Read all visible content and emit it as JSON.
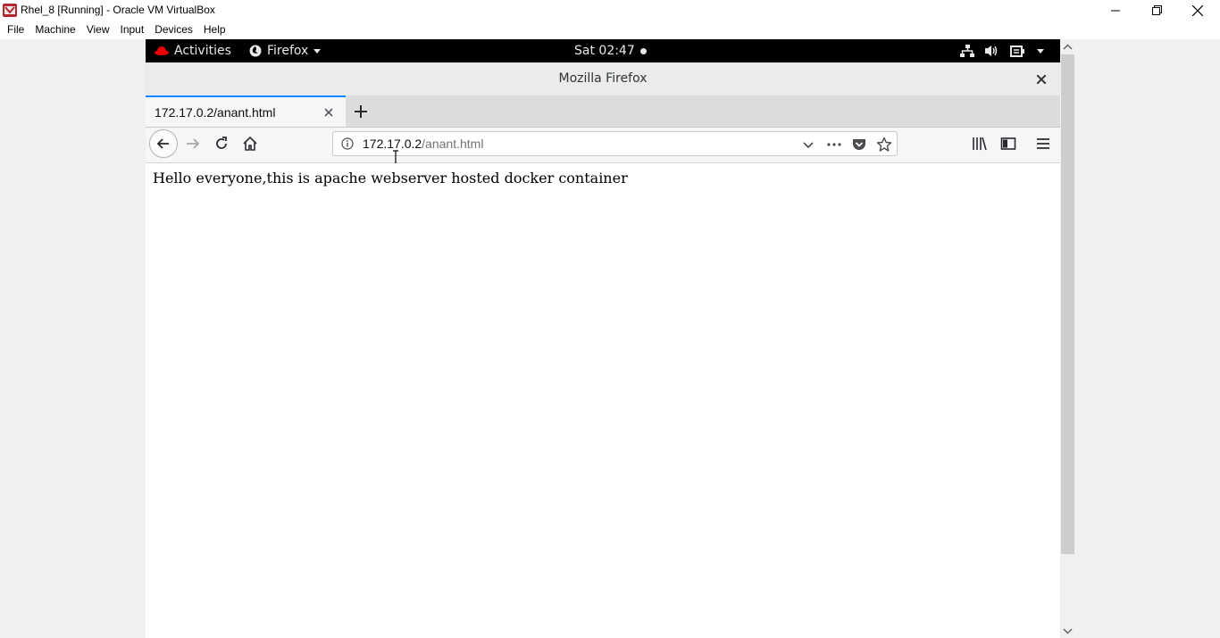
{
  "vbox": {
    "title": "Rhel_8 [Running] - Oracle VM VirtualBox",
    "menu": [
      "File",
      "Machine",
      "View",
      "Input",
      "Devices",
      "Help"
    ]
  },
  "gnome": {
    "activities": "Activities",
    "app": "Firefox",
    "clock": "Sat 02:47"
  },
  "firefox": {
    "window_title": "Mozilla Firefox",
    "tab_title": "172.17.0.2/anant.html",
    "url_host": "172.17.0.2",
    "url_path": "/anant.html"
  },
  "page": {
    "text": "Hello everyone,this is apache webserver hosted docker container"
  },
  "colors": {
    "accent": "#0a84ff",
    "redhat_red": "#ee0000",
    "gnome_bar": "#000000"
  },
  "icons": [
    "virtualbox-icon",
    "minimize-icon",
    "maximize-icon",
    "close-icon",
    "redhat-icon",
    "firefox-icon",
    "network-icon",
    "volume-icon",
    "battery-icon",
    "plus-icon",
    "back-arrow-icon",
    "forward-arrow-icon",
    "reload-icon",
    "home-icon",
    "info-icon",
    "dropdown-icon",
    "more-icon",
    "pocket-icon",
    "star-icon",
    "library-icon",
    "sidebar-icon",
    "hamburger-menu-icon"
  ]
}
